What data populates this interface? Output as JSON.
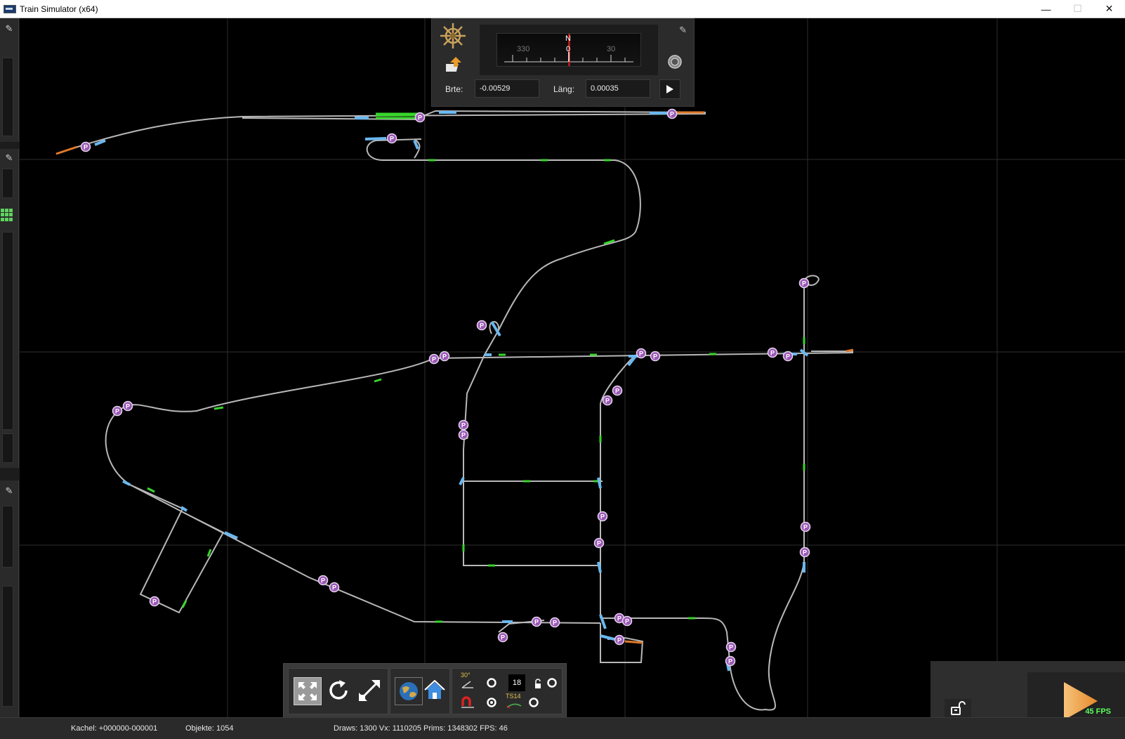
{
  "window": {
    "title": "Train Simulator (x64)",
    "min_glyph": "—",
    "max_glyph": "☐",
    "close_glyph": "✕"
  },
  "compass": {
    "ticks": [
      {
        "label": "330"
      },
      {
        "label": "N"
      },
      {
        "label": "0"
      },
      {
        "label": "30"
      }
    ],
    "lat_label": "Brte:",
    "lat_value": "-0.00529",
    "lon_label": "Läng:",
    "lon_value": "0.00035"
  },
  "toolbar": {
    "angle_label": "30°",
    "number_value": "18",
    "ts_label": "TS14"
  },
  "status": {
    "tile_text": "Kachel: +000000-000001",
    "objects_text": "Objekte: 1054",
    "render_text": "Draws: 1300 Vx: 1110205 Prims: 1348302 FPS: 46"
  },
  "play": {
    "fps_text": "45 FPS"
  },
  "map": {
    "marker_label": "P",
    "colors": {
      "track": "#b8b8b8",
      "grid": "#2e2e2e",
      "marker_fill": "#9b59b6",
      "marker_ring": "#e8d6f0",
      "highlight_green": "#37d62a",
      "highlight_blue": "#6ab8f0",
      "highlight_orange": "#e07a2b"
    }
  }
}
